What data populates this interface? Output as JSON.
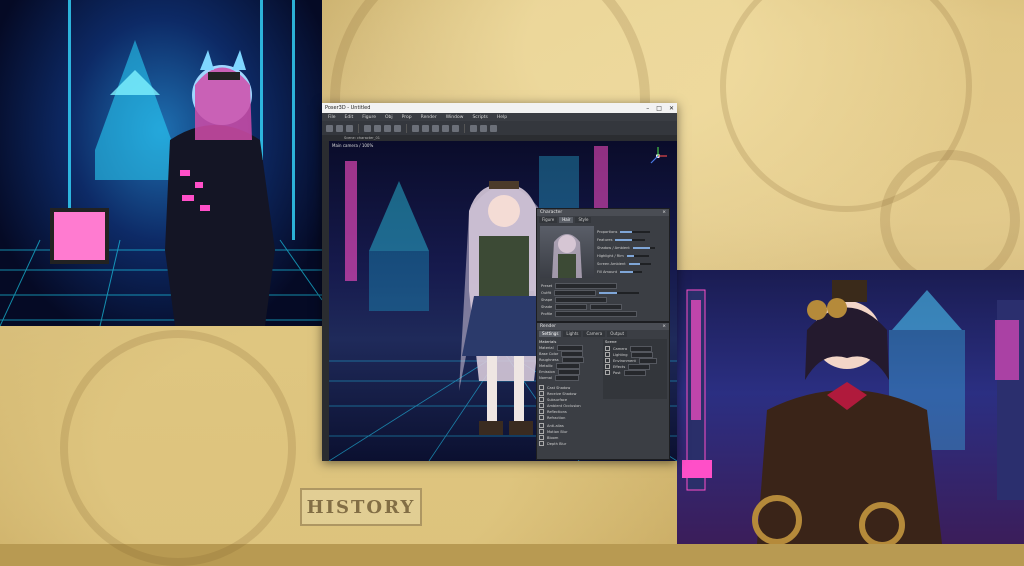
{
  "background": {
    "watermark_label": "HISTORY"
  },
  "app": {
    "window_title": "Poser3D - Untitled",
    "window_controls": [
      "–",
      "□",
      "✕"
    ],
    "menu": [
      "File",
      "Edit",
      "Figure",
      "Obj",
      "Prop",
      "Render",
      "Window",
      "Scripts",
      "Help"
    ],
    "doc_tab": "Scene: character_01",
    "viewport_label": "Main camera / 100%",
    "char_panel": {
      "title": "Character",
      "tabs": [
        "Figure",
        "Hair",
        "Style"
      ],
      "sliders": [
        "Proportions",
        "Features",
        "Shadow / Ambient",
        "Highlight / Rim",
        "Screen Ambient",
        "Fill Amount"
      ],
      "fields": [
        "Preset",
        "Outfit",
        "Shape",
        "Shade",
        "Profile"
      ]
    },
    "render_panel": {
      "title": "Render",
      "tabs": [
        "Settings",
        "Lights",
        "Camera",
        "Output"
      ],
      "section": "Materials",
      "rows": [
        "Material",
        "Base Color",
        "Roughness",
        "Metallic",
        "Emission",
        "Normal"
      ],
      "checks": [
        "Cast Shadow",
        "Receive Shadow",
        "Subsurface",
        "Ambient Occlusion",
        "Reflections",
        "Refraction",
        "Anti-alias",
        "Motion Blur",
        "Bloom",
        "Depth Blur"
      ],
      "right_header": "Scene",
      "right_rows": [
        "Camera",
        "Lighting",
        "Environment",
        "Effects",
        "Post"
      ]
    }
  },
  "colors": {
    "parchment": "#c8ad6a",
    "app_bg": "#2f3237",
    "neon_cyan": "#2fe6ff",
    "neon_pink": "#ff3fb4"
  }
}
